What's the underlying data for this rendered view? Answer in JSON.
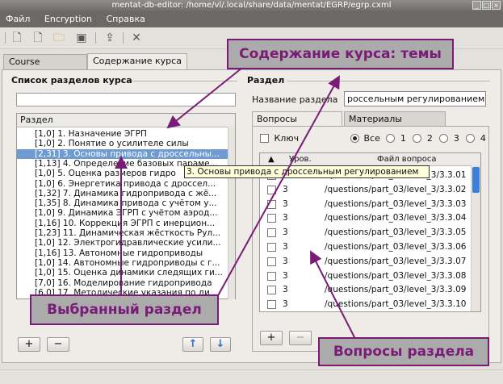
{
  "window": {
    "title": "mentat-db-editor: /home/vl/.local/share/data/mentat/EGRP/egrp.cxml"
  },
  "menu": [
    "Файл",
    "Encryption",
    "Справка"
  ],
  "tabs": {
    "course_selection": "Course selection",
    "course_content": "Содержание курса"
  },
  "left": {
    "group_title": "Список разделов курса",
    "search_value": "",
    "list_header": "Раздел",
    "items": [
      "[1,0] 1. Назначение ЭГРП",
      "[1,0] 2. Понятие о усилителе силы",
      "[2,31] 3. Основы привода с дроссельны...",
      "[1,13] 4. Определение базовых параме...",
      "[1,0] 5. Оценка размеров гидро",
      "[1,0] 6. Энергетика привода с дроссел...",
      "[1,32] 7. Динамика гидропривода с жё...",
      "[1,35] 8. Динамика привода с учётом у...",
      "[1,0] 9. Динамика ЭГРП с учётом аэрод...",
      "[1,16] 10. Коррекция ЭГРП с инерцион...",
      "[1,23] 11. Динамическая жёсткость Рул...",
      "[1,0] 12. Электрогидравлические усили...",
      "[1,16] 13. Автономные гидроприводы",
      "[1,0] 14. Автономные гидроприводы с г...",
      "[1,0] 15. Оценка динамики следящих ги...",
      "[7,0] 16. Моделирование гидропривода",
      "[6,0] 17. Методические указания по ди..."
    ],
    "selected_index": 2,
    "add_label": "+",
    "remove_label": "−",
    "up_label": "↑",
    "down_label": "↓"
  },
  "right": {
    "group_title": "Раздел",
    "name_label": "Название раздела",
    "name_value": "россельным регулированием",
    "subtabs": {
      "questions": "Вопросы раздела",
      "materials": "Материалы раздела"
    },
    "key_label": "Ключ",
    "filter_all": "Все",
    "filter_levels": [
      "1",
      "2",
      "3",
      "4"
    ],
    "table_headers": {
      "sort": "▲",
      "level": "Уров.",
      "file": "Файл вопроса"
    },
    "rows": [
      {
        "level": "3",
        "file": "/questions/part_03/level_3/3.3.01"
      },
      {
        "level": "3",
        "file": "/questions/part_03/level_3/3.3.02"
      },
      {
        "level": "3",
        "file": "/questions/part_03/level_3/3.3.03"
      },
      {
        "level": "3",
        "file": "/questions/part_03/level_3/3.3.04"
      },
      {
        "level": "3",
        "file": "/questions/part_03/level_3/3.3.05"
      },
      {
        "level": "3",
        "file": "/questions/part_03/level_3/3.3.06"
      },
      {
        "level": "3",
        "file": "/questions/part_03/level_3/3.3.07"
      },
      {
        "level": "3",
        "file": "/questions/part_03/level_3/3.3.08"
      },
      {
        "level": "3",
        "file": "/questions/part_03/level_3/3.3.09"
      },
      {
        "level": "3",
        "file": "/questions/part_03/level_3/3.3.10"
      }
    ],
    "add_label": "+",
    "remove_label": "−"
  },
  "tooltip": "3. Основы привода с дроссельным регулированием",
  "callouts": {
    "topics": "Содержание курса: темы",
    "selected": "Выбранный раздел",
    "questions": "Вопросы раздела"
  },
  "colors": {
    "selection": "#6e9bd4",
    "callout_border": "#7a1b78",
    "callout_bg": "#ababab",
    "menubar": "#6b6966"
  }
}
